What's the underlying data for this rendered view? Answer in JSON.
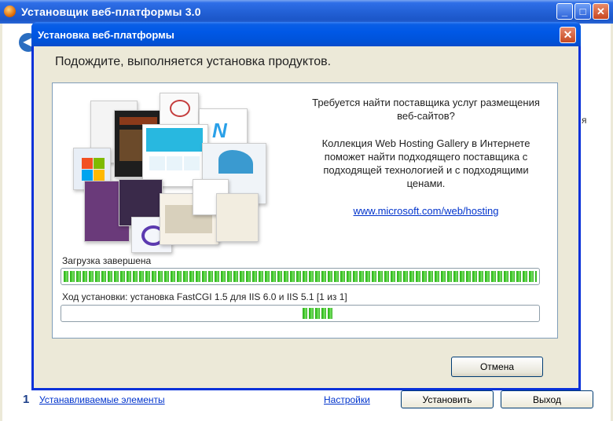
{
  "background_window": {
    "title": "Установщик веб-платформы 3.0",
    "buttons": {
      "minimize": "_",
      "maximize": "□",
      "close": "✕"
    },
    "back_icon": "◀",
    "clipped_text": "я",
    "count": "1",
    "items_link": "Устанавливаемые элементы",
    "settings_link": "Настройки",
    "install_button": "Установить",
    "exit_button": "Выход"
  },
  "dialog": {
    "title": "Установка веб-платформы",
    "close_icon": "✕",
    "heading": "Подождите, выполняется установка продуктов.",
    "info": {
      "question": "Требуется найти поставщика услуг размещения веб-сайтов?",
      "description": "Коллекция Web Hosting Gallery в Интернете поможет найти подходящего поставщика с подходящей технологией и с подходящими ценами.",
      "link": "www.microsoft.com/web/hosting"
    },
    "download": {
      "label": "Загрузка завершена",
      "progress": 1.0
    },
    "install": {
      "label": "Ход установки: установка FastCGI 1.5 для IIS 6.0 и IIS 5.1 [1 из 1]",
      "state": "marquee"
    },
    "cancel_button": "Отмена"
  },
  "colors": {
    "accent": "#0831d9",
    "progress_green": "#3fc92a",
    "link": "#0033cc"
  },
  "icons": [
    "app-icon",
    "minimize-icon",
    "maximize-icon",
    "close-icon",
    "back-arrow-icon",
    "windows-logo-icon",
    "visual-studio-logo-icon"
  ]
}
